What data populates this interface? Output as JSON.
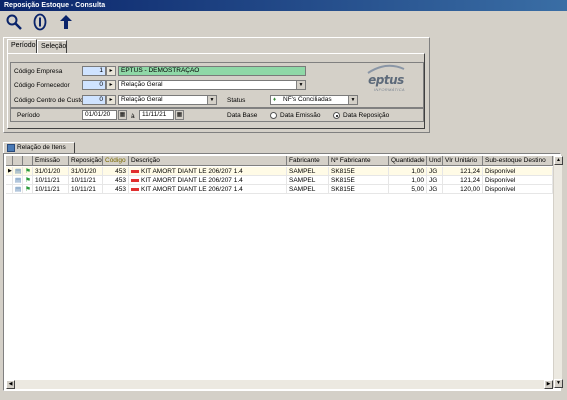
{
  "window": {
    "title": "Reposição Estoque - Consulta"
  },
  "toolbar": {
    "icons": [
      "search-icon",
      "info-icon",
      "back-arrow-icon"
    ]
  },
  "tabs": [
    "Período",
    "Seleção"
  ],
  "form": {
    "empresa_label": "Código Empresa",
    "empresa_code": "1",
    "empresa_name": "EPTUS - DEMOSTRAÇÃO",
    "fornecedor_label": "Código Fornecedor",
    "fornecedor_code": "0",
    "fornecedor_value": "Relação Geral",
    "centro_label": "Código Centro de Custo",
    "centro_code": "0",
    "centro_value": "Relação Geral",
    "status_label": "Status",
    "status_value": "NF's Conciliadas",
    "periodo_label": "Período",
    "date_from": "01/01/20",
    "date_sep": "à",
    "date_to": "11/11/21",
    "database_label": "Data Base",
    "radio_emissao": "Data Emissão",
    "radio_reposicao": "Data Reposição",
    "selected_radio": "Data Reposição"
  },
  "logo": {
    "name": "eptus",
    "tagline": "INFORMÁTICA"
  },
  "grid_section": {
    "title": "Relação de Itens"
  },
  "grid": {
    "columns": [
      "Emissão",
      "Reposição",
      "Código",
      "Descrição",
      "Fabricante",
      "Nº Fabricante",
      "Quantidade",
      "Und",
      "Vlr Unitário",
      "Sub-estoque Destino"
    ],
    "sorted_column": "Código",
    "rows": [
      {
        "emissao": "31/01/20",
        "reposicao": "31/01/20",
        "codigo": "453",
        "descricao": "KIT AMORT DIANT LE 206/207 1.4",
        "fabricante": "SAMPEL",
        "n_fabricante": "SK815E",
        "quantidade": "1,00",
        "und": "JG",
        "vlr_unitario": "121,24",
        "sub_estoque": "Disponível"
      },
      {
        "emissao": "10/11/21",
        "reposicao": "10/11/21",
        "codigo": "453",
        "descricao": "KIT AMORT DIANT LE 206/207 1.4",
        "fabricante": "SAMPEL",
        "n_fabricante": "SK815E",
        "quantidade": "1,00",
        "und": "JG",
        "vlr_unitario": "121,24",
        "sub_estoque": "Disponível"
      },
      {
        "emissao": "10/11/21",
        "reposicao": "10/11/21",
        "codigo": "453",
        "descricao": "KIT AMORT DIANT LE 206/207 1.4",
        "fabricante": "SAMPEL",
        "n_fabricante": "SK815E",
        "quantidade": "5,00",
        "und": "JG",
        "vlr_unitario": "120,00",
        "sub_estoque": "Disponível"
      }
    ]
  },
  "colors": {
    "title_bar": "#0a246a",
    "field_green": "#8fd8a7",
    "field_blue": "#cfe3ff",
    "dash_red": "#e03030"
  }
}
